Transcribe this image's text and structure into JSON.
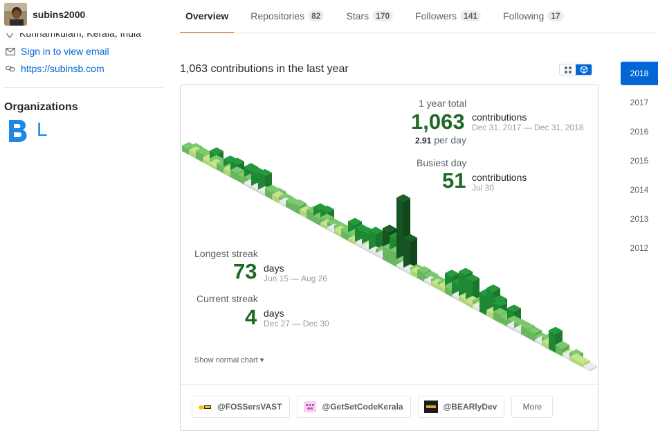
{
  "user": {
    "username": "subins2000"
  },
  "tabs": [
    {
      "label": "Overview"
    },
    {
      "label": "Repositories",
      "count": "82"
    },
    {
      "label": "Stars",
      "count": "170"
    },
    {
      "label": "Followers",
      "count": "141"
    },
    {
      "label": "Following",
      "count": "17"
    }
  ],
  "sidebar": {
    "location": "Kunnamkulam, Kerala, India",
    "email": "Sign in to view email",
    "url": "https://subinsb.com",
    "organizations_title": "Organizations",
    "org_l": "L"
  },
  "contributions": {
    "title": "1,063 contributions in the last year",
    "year_total_label": "1 year total",
    "year_total": "1,063",
    "year_total_unit": "contributions",
    "year_total_range": "Dec 31, 2017 — Dec 31, 2018",
    "per_day_value": "2.91",
    "per_day_label": " per day",
    "busiest_label": "Busiest day",
    "busiest_value": "51",
    "busiest_unit": "contributions",
    "busiest_date": "Jul 30",
    "longest_label": "Longest streak",
    "longest_value": "73",
    "longest_unit": "days",
    "longest_range": "Jun 15 — Aug 26",
    "current_label": "Current streak",
    "current_value": "4",
    "current_unit": "days",
    "current_range": "Dec 27 — Dec 30",
    "show_normal": "Show normal chart ▾"
  },
  "org_buttons": [
    {
      "label": "@FOSSersVAST"
    },
    {
      "label": "@GetSetCodeKerala"
    },
    {
      "label": "@BEARlyDev"
    }
  ],
  "more_label": "More",
  "years": [
    "2018",
    "2017",
    "2016",
    "2015",
    "2014",
    "2013",
    "2012"
  ],
  "colors": {
    "accent": "#0366d6",
    "tab_underline": "#e36209",
    "level0": "#ebedf0",
    "level1": "#c6e48b",
    "level2": "#7bc96f",
    "level3": "#239a3b",
    "level4": "#196127"
  }
}
